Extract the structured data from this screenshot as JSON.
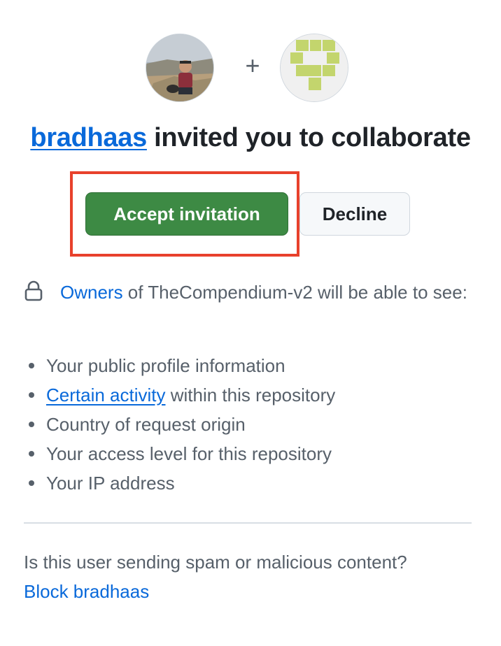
{
  "inviter": {
    "username": "bradhaas",
    "headline_rest": " invited you to collaborate"
  },
  "avatars": {
    "plus_symbol": "+",
    "user_avatar_icon": "user-photo-avatar",
    "org_avatar_icon": "identicon-avatar",
    "identicon_color": "#c3d56d"
  },
  "actions": {
    "accept_label": "Accept invitation",
    "decline_label": "Decline",
    "accept_color": "#3d8a44",
    "highlight_color": "#e8412c"
  },
  "disclosure": {
    "owners_link": "Owners",
    "text": " of TheCompendium-v2 will be able to see:",
    "items": [
      {
        "link": "",
        "text": "Your public profile information"
      },
      {
        "link": "Certain activity",
        "text": " within this repository"
      },
      {
        "link": "",
        "text": "Country of request origin"
      },
      {
        "link": "",
        "text": "Your access level for this repository"
      },
      {
        "link": "",
        "text": "Your IP address"
      }
    ]
  },
  "spam": {
    "question": "Is this user sending spam or malicious content?",
    "block_label": "Block bradhaas"
  }
}
